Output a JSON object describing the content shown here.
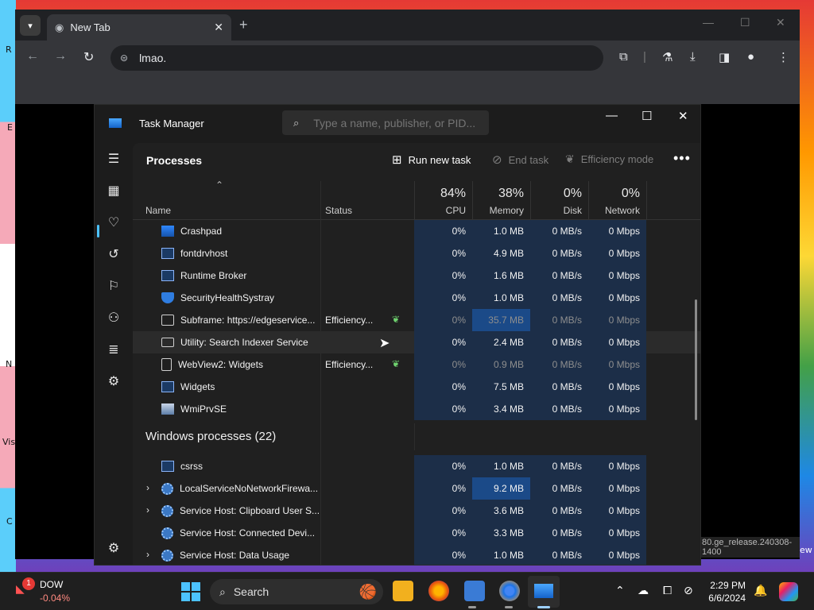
{
  "wallpaper": {
    "edge_letters": [
      "R",
      "E",
      "N",
      "Vis",
      "C"
    ],
    "right_text": "ew"
  },
  "browser": {
    "tab_title": "New Tab",
    "address": "lmao.",
    "status_url": "80.ge_release.240308-1400"
  },
  "task_manager": {
    "title": "Task Manager",
    "search_placeholder": "Type a name, publisher, or PID...",
    "page_title": "Processes",
    "commands": {
      "run_new_task": "Run new task",
      "end_task": "End task",
      "efficiency_mode": "Efficiency mode"
    },
    "columns": {
      "name": "Name",
      "status": "Status",
      "cpu": {
        "pct": "84%",
        "label": "CPU"
      },
      "memory": {
        "pct": "38%",
        "label": "Memory"
      },
      "disk": {
        "pct": "0%",
        "label": "Disk"
      },
      "network": {
        "pct": "0%",
        "label": "Network"
      }
    },
    "processes": [
      {
        "name": "Crashpad",
        "icon": "crashpad-icon",
        "status": "",
        "cpu": "0%",
        "memory": "1.0 MB",
        "disk": "0 MB/s",
        "network": "0 Mbps"
      },
      {
        "name": "fontdrvhost",
        "icon": "window-icon",
        "status": "",
        "cpu": "0%",
        "memory": "4.9 MB",
        "disk": "0 MB/s",
        "network": "0 Mbps"
      },
      {
        "name": "Runtime Broker",
        "icon": "window-icon",
        "status": "",
        "cpu": "0%",
        "memory": "1.6 MB",
        "disk": "0 MB/s",
        "network": "0 Mbps"
      },
      {
        "name": "SecurityHealthSystray",
        "icon": "shield-icon",
        "status": "",
        "cpu": "0%",
        "memory": "1.0 MB",
        "disk": "0 MB/s",
        "network": "0 Mbps"
      },
      {
        "name": "Subframe: https://edgeservice...",
        "icon": "frame-icon",
        "status": "Efficiency...",
        "cpu": "0%",
        "memory": "35.7 MB",
        "disk": "0 MB/s",
        "network": "0 Mbps"
      },
      {
        "name": "Utility: Search Indexer Service",
        "icon": "briefcase-icon",
        "status": "",
        "cpu": "0%",
        "memory": "2.4 MB",
        "disk": "0 MB/s",
        "network": "0 Mbps"
      },
      {
        "name": "WebView2: Widgets",
        "icon": "document-icon",
        "status": "Efficiency...",
        "cpu": "0%",
        "memory": "0.9 MB",
        "disk": "0 MB/s",
        "network": "0 Mbps"
      },
      {
        "name": "Widgets",
        "icon": "window-icon",
        "status": "",
        "cpu": "0%",
        "memory": "7.5 MB",
        "disk": "0 MB/s",
        "network": "0 Mbps"
      },
      {
        "name": "WmiPrvSE",
        "icon": "wmi-icon",
        "status": "",
        "cpu": "0%",
        "memory": "3.4 MB",
        "disk": "0 MB/s",
        "network": "0 Mbps"
      }
    ],
    "windows_group_title": "Windows processes (22)",
    "windows_processes": [
      {
        "name": "csrss",
        "icon": "window-icon",
        "expandable": false,
        "cpu": "0%",
        "memory": "1.0 MB",
        "disk": "0 MB/s",
        "network": "0 Mbps"
      },
      {
        "name": "LocalServiceNoNetworkFirewa...",
        "icon": "gear-icon",
        "expandable": true,
        "cpu": "0%",
        "memory": "9.2 MB",
        "disk": "0 MB/s",
        "network": "0 Mbps"
      },
      {
        "name": "Service Host: Clipboard User S...",
        "icon": "gear-icon",
        "expandable": true,
        "cpu": "0%",
        "memory": "3.6 MB",
        "disk": "0 MB/s",
        "network": "0 Mbps"
      },
      {
        "name": "Service Host: Connected Devi...",
        "icon": "gear-icon",
        "expandable": false,
        "cpu": "0%",
        "memory": "3.3 MB",
        "disk": "0 MB/s",
        "network": "0 Mbps"
      },
      {
        "name": "Service Host: Data Usage",
        "icon": "gear-icon",
        "expandable": true,
        "cpu": "0%",
        "memory": "1.0 MB",
        "disk": "0 MB/s",
        "network": "0 Mbps"
      }
    ]
  },
  "taskbar": {
    "weather_badge": "1",
    "ticker": "DOW",
    "ticker_change": "-0.04%",
    "search_label": "Search",
    "time": "2:29 PM",
    "date": "6/6/2024"
  }
}
